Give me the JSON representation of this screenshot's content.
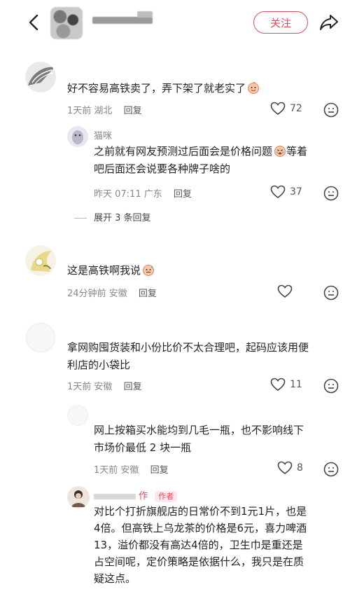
{
  "header": {
    "follow_label": "关注"
  },
  "comments": [
    {
      "text": "好不容易高铁卖了，弄下架了就老实了",
      "time": "1天前",
      "location": "湖北",
      "reply_label": "回复",
      "likes": "72"
    }
  ],
  "reply1": {
    "username": "猫咪",
    "text_line1": "之前就有网友预测过后面会是价格问题",
    "text_line1b": "等着",
    "text_line2": "吧后面还会说要各种牌子啥的",
    "time": "昨天 07:11",
    "location": "广东",
    "reply_label": "回复",
    "likes": "37",
    "expand_label": "展开 3 条回复"
  },
  "comment2": {
    "text": "这是高铁啊我说",
    "time": "24分钟前",
    "location": "安徽",
    "reply_label": "回复"
  },
  "comment3": {
    "text_line1": "拿网购囤货装和小份比价不太合理吧，起码应该用便",
    "text_line2": "利店的小袋比",
    "time": "1天前",
    "location": "安徽",
    "reply_label": "回复",
    "likes": "11"
  },
  "reply2": {
    "text_line1": "网上按箱买水能均到几毛一瓶，也不影响线下",
    "text_line2": "市场价最低 2 块一瓶",
    "time": "1天前",
    "location": "安徽",
    "reply_label": "回复",
    "likes": "8"
  },
  "reply3": {
    "username_partial": "作",
    "author_tag": "作者",
    "text_line1": "对比个打折旗舰店的日常价不到1元1片，也是",
    "text_line2": "4倍。但高铁上乌龙茶的价格是6元，喜力啤酒",
    "text_line3": "13，溢价都没有高达4倍的，卫生巾是重还是",
    "text_line4": "占空间呢，定价策略是依据什么，我只是在质",
    "text_line5": "疑这点。"
  }
}
